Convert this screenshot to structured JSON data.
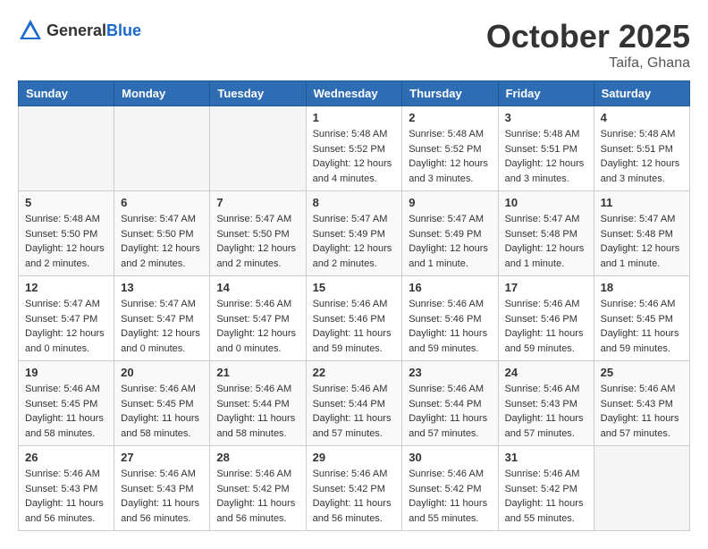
{
  "header": {
    "logo_general": "General",
    "logo_blue": "Blue",
    "month_title": "October 2025",
    "location": "Taifa, Ghana"
  },
  "days_of_week": [
    "Sunday",
    "Monday",
    "Tuesday",
    "Wednesday",
    "Thursday",
    "Friday",
    "Saturday"
  ],
  "weeks": [
    [
      {
        "day": "",
        "info": ""
      },
      {
        "day": "",
        "info": ""
      },
      {
        "day": "",
        "info": ""
      },
      {
        "day": "1",
        "info": "Sunrise: 5:48 AM\nSunset: 5:52 PM\nDaylight: 12 hours\nand 4 minutes."
      },
      {
        "day": "2",
        "info": "Sunrise: 5:48 AM\nSunset: 5:52 PM\nDaylight: 12 hours\nand 3 minutes."
      },
      {
        "day": "3",
        "info": "Sunrise: 5:48 AM\nSunset: 5:51 PM\nDaylight: 12 hours\nand 3 minutes."
      },
      {
        "day": "4",
        "info": "Sunrise: 5:48 AM\nSunset: 5:51 PM\nDaylight: 12 hours\nand 3 minutes."
      }
    ],
    [
      {
        "day": "5",
        "info": "Sunrise: 5:48 AM\nSunset: 5:50 PM\nDaylight: 12 hours\nand 2 minutes."
      },
      {
        "day": "6",
        "info": "Sunrise: 5:47 AM\nSunset: 5:50 PM\nDaylight: 12 hours\nand 2 minutes."
      },
      {
        "day": "7",
        "info": "Sunrise: 5:47 AM\nSunset: 5:50 PM\nDaylight: 12 hours\nand 2 minutes."
      },
      {
        "day": "8",
        "info": "Sunrise: 5:47 AM\nSunset: 5:49 PM\nDaylight: 12 hours\nand 2 minutes."
      },
      {
        "day": "9",
        "info": "Sunrise: 5:47 AM\nSunset: 5:49 PM\nDaylight: 12 hours\nand 1 minute."
      },
      {
        "day": "10",
        "info": "Sunrise: 5:47 AM\nSunset: 5:48 PM\nDaylight: 12 hours\nand 1 minute."
      },
      {
        "day": "11",
        "info": "Sunrise: 5:47 AM\nSunset: 5:48 PM\nDaylight: 12 hours\nand 1 minute."
      }
    ],
    [
      {
        "day": "12",
        "info": "Sunrise: 5:47 AM\nSunset: 5:47 PM\nDaylight: 12 hours\nand 0 minutes."
      },
      {
        "day": "13",
        "info": "Sunrise: 5:47 AM\nSunset: 5:47 PM\nDaylight: 12 hours\nand 0 minutes."
      },
      {
        "day": "14",
        "info": "Sunrise: 5:46 AM\nSunset: 5:47 PM\nDaylight: 12 hours\nand 0 minutes."
      },
      {
        "day": "15",
        "info": "Sunrise: 5:46 AM\nSunset: 5:46 PM\nDaylight: 11 hours\nand 59 minutes."
      },
      {
        "day": "16",
        "info": "Sunrise: 5:46 AM\nSunset: 5:46 PM\nDaylight: 11 hours\nand 59 minutes."
      },
      {
        "day": "17",
        "info": "Sunrise: 5:46 AM\nSunset: 5:46 PM\nDaylight: 11 hours\nand 59 minutes."
      },
      {
        "day": "18",
        "info": "Sunrise: 5:46 AM\nSunset: 5:45 PM\nDaylight: 11 hours\nand 59 minutes."
      }
    ],
    [
      {
        "day": "19",
        "info": "Sunrise: 5:46 AM\nSunset: 5:45 PM\nDaylight: 11 hours\nand 58 minutes."
      },
      {
        "day": "20",
        "info": "Sunrise: 5:46 AM\nSunset: 5:45 PM\nDaylight: 11 hours\nand 58 minutes."
      },
      {
        "day": "21",
        "info": "Sunrise: 5:46 AM\nSunset: 5:44 PM\nDaylight: 11 hours\nand 58 minutes."
      },
      {
        "day": "22",
        "info": "Sunrise: 5:46 AM\nSunset: 5:44 PM\nDaylight: 11 hours\nand 57 minutes."
      },
      {
        "day": "23",
        "info": "Sunrise: 5:46 AM\nSunset: 5:44 PM\nDaylight: 11 hours\nand 57 minutes."
      },
      {
        "day": "24",
        "info": "Sunrise: 5:46 AM\nSunset: 5:43 PM\nDaylight: 11 hours\nand 57 minutes."
      },
      {
        "day": "25",
        "info": "Sunrise: 5:46 AM\nSunset: 5:43 PM\nDaylight: 11 hours\nand 57 minutes."
      }
    ],
    [
      {
        "day": "26",
        "info": "Sunrise: 5:46 AM\nSunset: 5:43 PM\nDaylight: 11 hours\nand 56 minutes."
      },
      {
        "day": "27",
        "info": "Sunrise: 5:46 AM\nSunset: 5:43 PM\nDaylight: 11 hours\nand 56 minutes."
      },
      {
        "day": "28",
        "info": "Sunrise: 5:46 AM\nSunset: 5:42 PM\nDaylight: 11 hours\nand 56 minutes."
      },
      {
        "day": "29",
        "info": "Sunrise: 5:46 AM\nSunset: 5:42 PM\nDaylight: 11 hours\nand 56 minutes."
      },
      {
        "day": "30",
        "info": "Sunrise: 5:46 AM\nSunset: 5:42 PM\nDaylight: 11 hours\nand 55 minutes."
      },
      {
        "day": "31",
        "info": "Sunrise: 5:46 AM\nSunset: 5:42 PM\nDaylight: 11 hours\nand 55 minutes."
      },
      {
        "day": "",
        "info": ""
      }
    ]
  ]
}
